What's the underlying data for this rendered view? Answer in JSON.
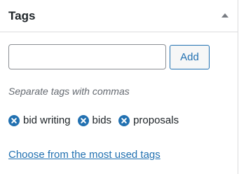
{
  "panel": {
    "title": "Tags",
    "toggle_icon": "triangle-up-icon"
  },
  "tag_input": {
    "value": "",
    "placeholder": ""
  },
  "add_button": {
    "label": "Add"
  },
  "hint": "Separate tags with commas",
  "tags": [
    {
      "label": "bid writing",
      "remove_icon": "remove-circle-x-icon"
    },
    {
      "label": "bids",
      "remove_icon": "remove-circle-x-icon"
    },
    {
      "label": "proposals",
      "remove_icon": "remove-circle-x-icon"
    }
  ],
  "most_used_link": "Choose from the most used tags",
  "colors": {
    "accent": "#2271b1",
    "text": "#1d2327",
    "muted": "#646970",
    "border": "#dcdcde",
    "input_border": "#8c8f94",
    "arrow": "#787c82",
    "button_bg": "#f6f7f7"
  }
}
